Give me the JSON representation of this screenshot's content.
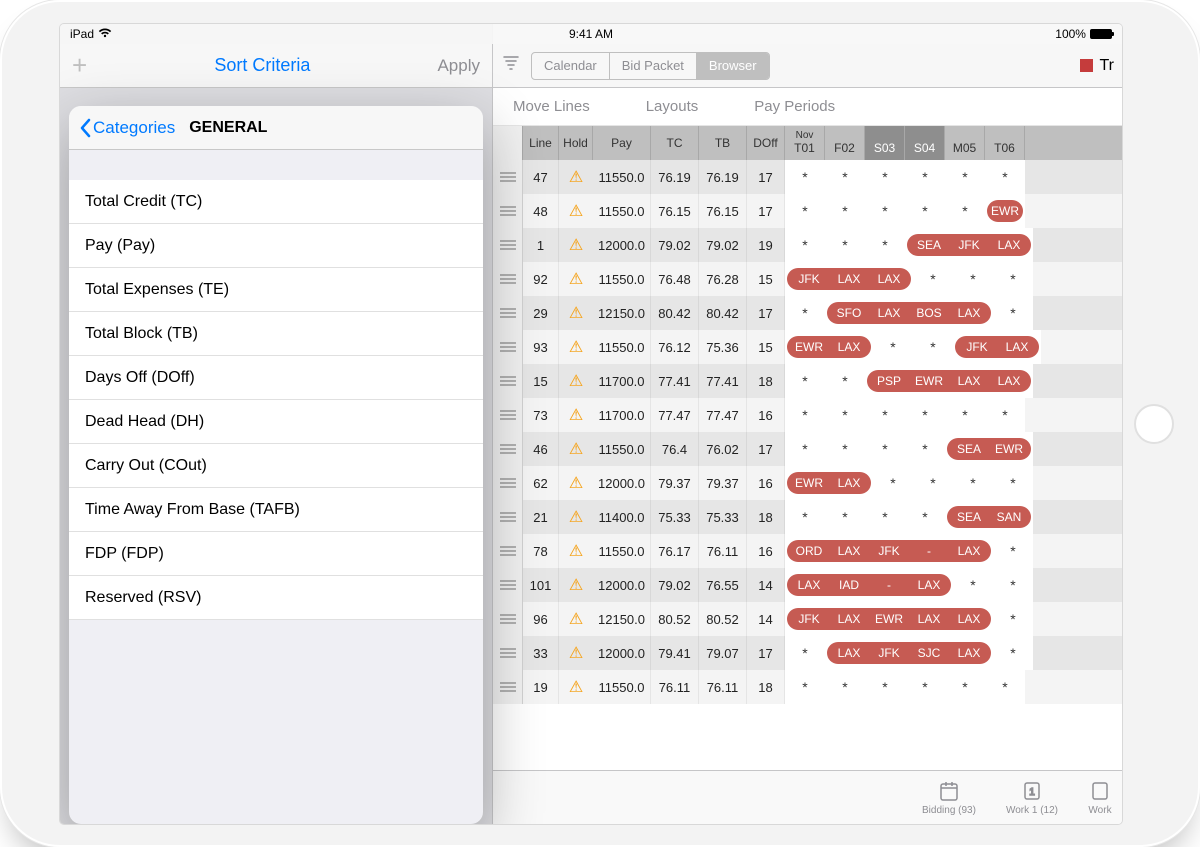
{
  "status": {
    "device": "iPad",
    "time": "9:41 AM",
    "battery": "100%"
  },
  "left": {
    "title": "Sort Criteria",
    "apply": "Apply",
    "back": "Categories",
    "header": "GENERAL",
    "items": [
      "Total Credit (TC)",
      "Pay (Pay)",
      "Total Expenses (TE)",
      "Total Block (TB)",
      "Days Off (DOff)",
      "Dead Head (DH)",
      "Carry Out (COut)",
      "Time Away From Base (TAFB)",
      "FDP (FDP)",
      "Reserved (RSV)"
    ]
  },
  "right": {
    "segments": [
      "Calendar",
      "Bid Packet",
      "Browser"
    ],
    "active_segment": 2,
    "badge": "Tr",
    "menu": [
      "Move Lines",
      "Layouts",
      "Pay Periods"
    ],
    "columns": [
      "Line",
      "Hold",
      "Pay",
      "TC",
      "TB",
      "DOff"
    ],
    "days": [
      {
        "top": "Nov",
        "bot": "T01",
        "shade": false
      },
      {
        "top": "",
        "bot": "F02",
        "shade": false
      },
      {
        "top": "",
        "bot": "S03",
        "shade": true
      },
      {
        "top": "",
        "bot": "S04",
        "shade": true
      },
      {
        "top": "",
        "bot": "M05",
        "shade": false
      },
      {
        "top": "",
        "bot": "T06",
        "shade": false
      }
    ],
    "rows": [
      {
        "line": 47,
        "pay": "11550.0",
        "tc": "76.19",
        "tb": "76.19",
        "doff": 17,
        "slots": [
          "*",
          "*",
          "*",
          "*",
          "*",
          "*"
        ]
      },
      {
        "line": 48,
        "pay": "11550.0",
        "tc": "76.15",
        "tb": "76.15",
        "doff": 17,
        "slots": [
          "*",
          "*",
          "*",
          "*",
          "*",
          "EWR"
        ]
      },
      {
        "line": 1,
        "pay": "12000.0",
        "tc": "79.02",
        "tb": "79.02",
        "doff": 19,
        "slots": [
          "*",
          "*",
          "*",
          "SEA",
          "JFK",
          "LAX"
        ]
      },
      {
        "line": 92,
        "pay": "11550.0",
        "tc": "76.48",
        "tb": "76.28",
        "doff": 15,
        "slots": [
          "JFK",
          "LAX",
          "LAX",
          "*",
          "*",
          "*"
        ]
      },
      {
        "line": 29,
        "pay": "12150.0",
        "tc": "80.42",
        "tb": "80.42",
        "doff": 17,
        "slots": [
          "*",
          "SFO",
          "LAX",
          "BOS",
          "LAX",
          "*"
        ]
      },
      {
        "line": 93,
        "pay": "11550.0",
        "tc": "76.12",
        "tb": "75.36",
        "doff": 15,
        "slots": [
          "EWR",
          "LAX",
          "*",
          "*",
          "JFK",
          "LAX"
        ]
      },
      {
        "line": 15,
        "pay": "11700.0",
        "tc": "77.41",
        "tb": "77.41",
        "doff": 18,
        "slots": [
          "*",
          "*",
          "PSP",
          "EWR",
          "LAX",
          "LAX"
        ]
      },
      {
        "line": 73,
        "pay": "11700.0",
        "tc": "77.47",
        "tb": "77.47",
        "doff": 16,
        "slots": [
          "*",
          "*",
          "*",
          "*",
          "*",
          "*"
        ]
      },
      {
        "line": 46,
        "pay": "11550.0",
        "tc": "76.4",
        "tb": "76.02",
        "doff": 17,
        "slots": [
          "*",
          "*",
          "*",
          "*",
          "SEA",
          "EWR"
        ]
      },
      {
        "line": 62,
        "pay": "12000.0",
        "tc": "79.37",
        "tb": "79.37",
        "doff": 16,
        "slots": [
          "EWR",
          "LAX",
          "*",
          "*",
          "*",
          "*"
        ]
      },
      {
        "line": 21,
        "pay": "11400.0",
        "tc": "75.33",
        "tb": "75.33",
        "doff": 18,
        "slots": [
          "*",
          "*",
          "*",
          "*",
          "SEA",
          "SAN"
        ]
      },
      {
        "line": 78,
        "pay": "11550.0",
        "tc": "76.17",
        "tb": "76.11",
        "doff": 16,
        "slots": [
          "ORD",
          "LAX",
          "JFK",
          "-",
          "LAX",
          "*"
        ]
      },
      {
        "line": 101,
        "pay": "12000.0",
        "tc": "79.02",
        "tb": "76.55",
        "doff": 14,
        "slots": [
          "LAX",
          "IAD",
          "-",
          "LAX",
          "*",
          "*"
        ]
      },
      {
        "line": 96,
        "pay": "12150.0",
        "tc": "80.52",
        "tb": "80.52",
        "doff": 14,
        "slots": [
          "JFK",
          "LAX",
          "EWR",
          "LAX",
          "LAX",
          "*"
        ]
      },
      {
        "line": 33,
        "pay": "12000.0",
        "tc": "79.41",
        "tb": "79.07",
        "doff": 17,
        "slots": [
          "*",
          "LAX",
          "JFK",
          "SJC",
          "LAX",
          "*"
        ]
      },
      {
        "line": 19,
        "pay": "11550.0",
        "tc": "76.11",
        "tb": "76.11",
        "doff": 18,
        "slots": [
          "*",
          "*",
          "*",
          "*",
          "*",
          "*"
        ]
      }
    ],
    "tabs": [
      {
        "label": "Bidding (93)"
      },
      {
        "label": "Work 1 (12)"
      },
      {
        "label": "Work"
      }
    ]
  }
}
